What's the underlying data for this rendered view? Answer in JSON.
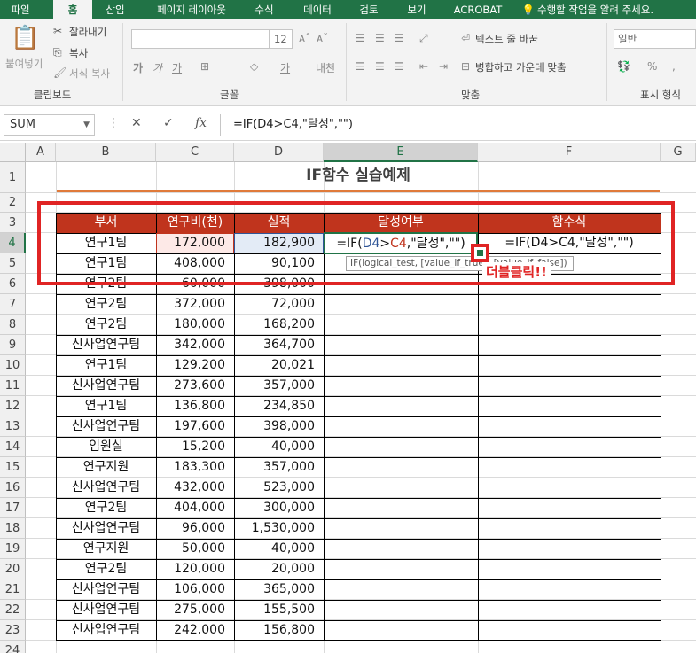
{
  "tabs": [
    "파일",
    "홈",
    "삽입",
    "페이지 레이아웃",
    "수식",
    "데이터",
    "검토",
    "보기",
    "ACROBAT",
    "수행할 작업을 알려 주세요."
  ],
  "ribbon": {
    "clipboard": {
      "paste": "붙여넣기",
      "cut": "잘라내기",
      "copy": "복사",
      "format_painter": "서식 복사",
      "group": "클립보드"
    },
    "font": {
      "size": "12",
      "group": "글꼴"
    },
    "align": {
      "wrap": "텍스트 줄 바꿈",
      "merge": "병합하고 가운데 맞춤",
      "group": "맞춤"
    },
    "number": {
      "format": "일반",
      "group": "표시 형식"
    }
  },
  "formula_bar": {
    "name_box": "SUM",
    "cancel": "✕",
    "enter": "✓",
    "fx": "fx",
    "formula": "=IF(D4>C4,\"달성\",\"\")"
  },
  "columns": [
    "A",
    "B",
    "C",
    "D",
    "E",
    "F",
    "G"
  ],
  "rows": [
    "1",
    "2",
    "3",
    "4",
    "5",
    "6",
    "7",
    "8",
    "9",
    "10",
    "11",
    "12",
    "13",
    "14",
    "15",
    "16",
    "17",
    "18",
    "19",
    "20",
    "21",
    "22",
    "23",
    "24"
  ],
  "sheet": {
    "title": "IF함수 실습예제",
    "headers": [
      "부서",
      "연구비(천)",
      "실적",
      "달성여부",
      "함수식"
    ],
    "data": [
      [
        "연구1팀",
        "172,000",
        "182,900"
      ],
      [
        "연구1팀",
        "408,000",
        "90,100"
      ],
      [
        "연구2팀",
        "60,000",
        "398,000"
      ],
      [
        "연구2팀",
        "372,000",
        "72,000"
      ],
      [
        "연구2팀",
        "180,000",
        "168,200"
      ],
      [
        "신사업연구팀",
        "342,000",
        "364,700"
      ],
      [
        "연구1팀",
        "129,200",
        "20,021"
      ],
      [
        "신사업연구팀",
        "273,600",
        "357,000"
      ],
      [
        "연구1팀",
        "136,800",
        "234,850"
      ],
      [
        "신사업연구팀",
        "197,600",
        "398,000"
      ],
      [
        "임원실",
        "15,200",
        "40,000"
      ],
      [
        "연구지원",
        "183,300",
        "357,000"
      ],
      [
        "신사업연구팀",
        "432,000",
        "523,000"
      ],
      [
        "연구2팀",
        "404,000",
        "300,000"
      ],
      [
        "신사업연구팀",
        "96,000",
        "1,530,000"
      ],
      [
        "연구지원",
        "50,000",
        "40,000"
      ],
      [
        "연구2팀",
        "120,000",
        "20,000"
      ],
      [
        "신사업연구팀",
        "106,000",
        "365,000"
      ],
      [
        "신사업연구팀",
        "275,000",
        "155,500"
      ],
      [
        "신사업연구팀",
        "242,000",
        "156,800"
      ]
    ],
    "edit_formula": {
      "p1": "=IF(",
      "d4": "D4",
      ">": ">",
      "c4": "C4",
      "p2": ",\"달성\",\"\")"
    },
    "f4_text": "=IF(D4>C4,\"달성\",\"\")",
    "tooltip": "IF(logical_test, [value_if_true], [value_if_false])",
    "annotation": "더블클릭!!"
  },
  "colors": {
    "accent": "#217346",
    "header_fill": "#c0341d",
    "highlight": "#e02424"
  }
}
